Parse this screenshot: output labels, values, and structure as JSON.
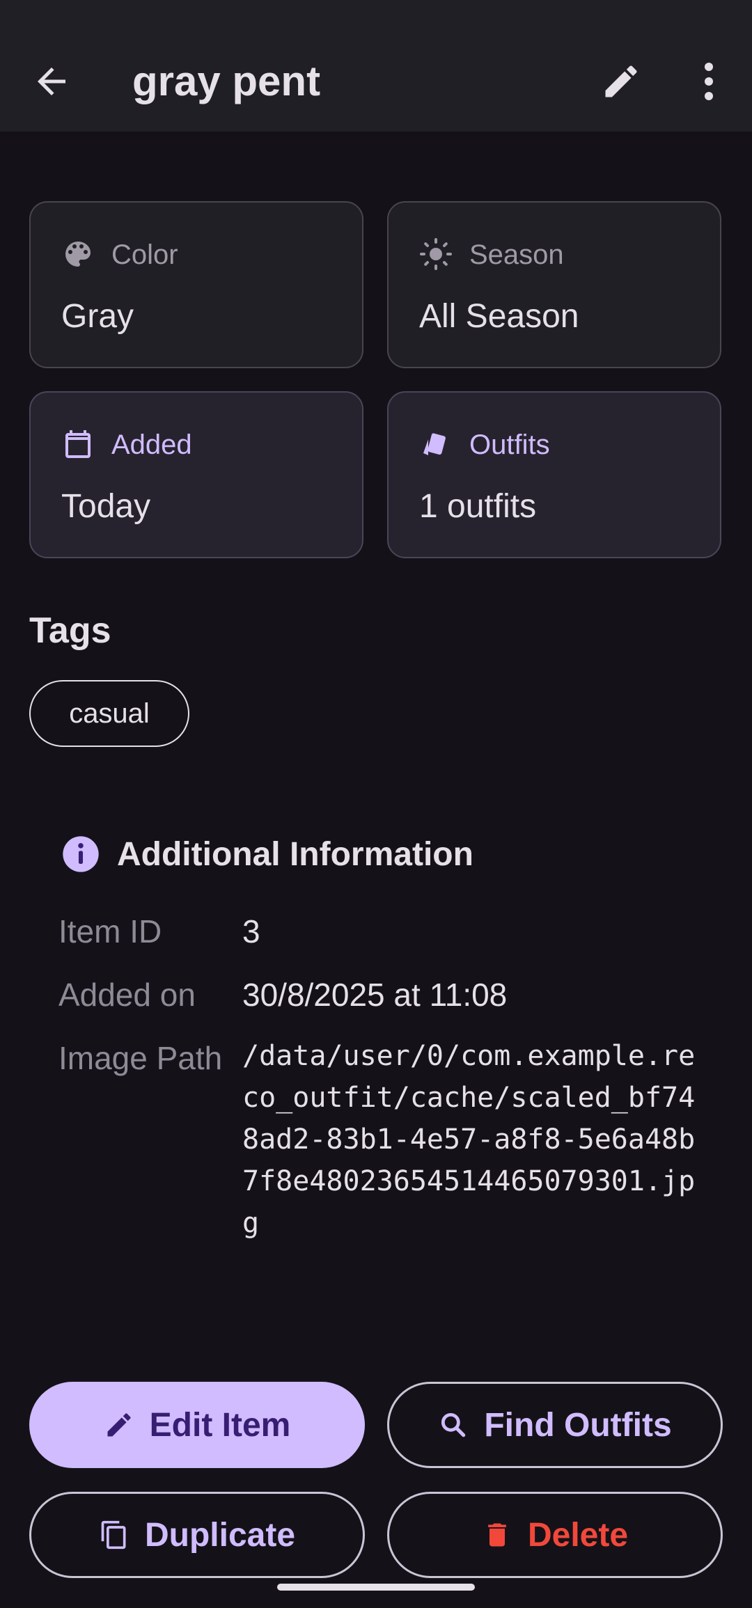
{
  "appbar": {
    "title": "gray pent"
  },
  "cards": {
    "color": {
      "label": "Color",
      "value": "Gray"
    },
    "season": {
      "label": "Season",
      "value": "All Season"
    },
    "added": {
      "label": "Added",
      "value": "Today"
    },
    "outfits": {
      "label": "Outfits",
      "value": "1 outfits"
    }
  },
  "tags": {
    "title": "Tags",
    "items": [
      "casual"
    ]
  },
  "info": {
    "title": "Additional Information",
    "rows": {
      "item_id": {
        "label": "Item ID",
        "value": "3"
      },
      "added_on": {
        "label": "Added on",
        "value": "30/8/2025 at 11:08"
      },
      "image_path": {
        "label": "Image Path",
        "value": "/data/user/0/com.example.reco_outfit/cache/scaled_bf748ad2-83b1-4e57-a8f8-5e6a48b7f8e48023654514465079301.jpg"
      }
    }
  },
  "actions": {
    "edit": "Edit Item",
    "find": "Find Outfits",
    "duplicate": "Duplicate",
    "delete": "Delete"
  },
  "colors": {
    "background": "#141218",
    "surface": "#211f26",
    "primary": "#d0bcff",
    "on_primary": "#381e72",
    "danger": "#f2483b"
  },
  "icons": {
    "back": "arrow-back-icon",
    "edit": "pencil-icon",
    "more": "more-vert-icon",
    "color": "palette-icon",
    "season": "sun-icon",
    "added": "calendar-icon",
    "outfits": "style-cards-icon",
    "info": "info-icon",
    "find": "search-icon",
    "duplicate": "copy-icon",
    "delete": "trash-icon"
  }
}
